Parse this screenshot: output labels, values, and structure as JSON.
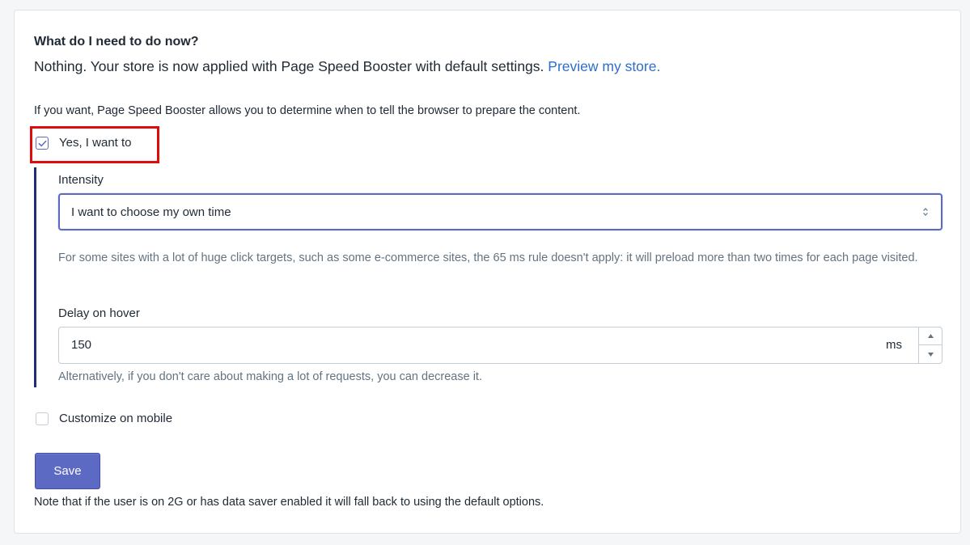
{
  "section": {
    "title": "What do I need to do now?",
    "answer_text": "Nothing. Your store is now applied with Page Speed Booster with default settings.",
    "preview_link": "Preview my store."
  },
  "intro_text": "If you want, Page Speed Booster allows you to determine when to tell the browser to prepare the content.",
  "opt_in": {
    "label": "Yes, I want to",
    "checked": true
  },
  "intensity": {
    "label": "Intensity",
    "selected": "I want to choose my own time",
    "help": "For some sites with a lot of huge click targets, such as some e-commerce sites, the 65 ms rule doesn't apply: it will preload more than two times for each page visited."
  },
  "delay": {
    "label": "Delay on hover",
    "value": "150",
    "suffix": "ms",
    "help": "Alternatively, if you don't care about making a lot of requests, you can decrease it."
  },
  "mobile": {
    "label": "Customize on mobile",
    "checked": false
  },
  "save_label": "Save",
  "note": "Note that if the user is on 2G or has data saver enabled it will fall back to using the default options.",
  "colors": {
    "accent": "#5c6ac4",
    "link": "#2c6ecb",
    "highlight": "#e00b0b",
    "side_bar": "#202e78"
  },
  "icons": {
    "checkmark": "check-icon",
    "select_arrows": "select-arrows-icon",
    "stepper_up": "chevron-up-icon",
    "stepper_down": "chevron-down-icon"
  }
}
